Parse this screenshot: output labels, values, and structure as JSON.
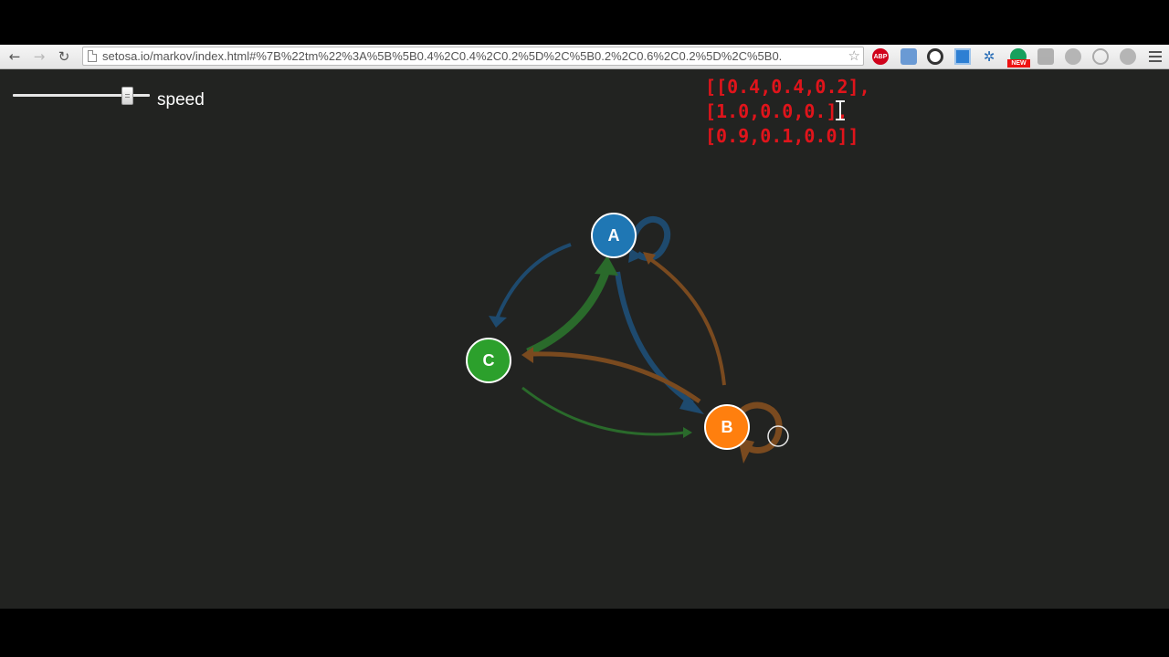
{
  "browser": {
    "url": "setosa.io/markov/index.html#%7B%22tm%22%3A%5B%5B0.4%2C0.4%2C0.2%5D%2C%5B0.2%2C0.6%2C0.2%5D%2C%5B0.",
    "nav": {
      "back_icon": "←",
      "forward_icon": "→",
      "reload_icon": "↻",
      "star_icon": "☆"
    },
    "extensions": {
      "abp_label": "ABP",
      "new_badge": "NEW"
    }
  },
  "controls": {
    "speed_label": "speed",
    "speed_slider_value": 0.87
  },
  "matrix": {
    "rows": [
      "[[0.4,0.4,0.2],",
      "[1.0,0.0,0.",
      "[0.9,0.1,0.0]]"
    ],
    "row_suffix_after_cursor": "],"
  },
  "graph": {
    "nodes": [
      {
        "id": "A",
        "label": "A",
        "color": "#1f77b4"
      },
      {
        "id": "B",
        "label": "B",
        "color": "#ff7f0e"
      },
      {
        "id": "C",
        "label": "C",
        "color": "#2ca02c"
      }
    ],
    "edge_colors": {
      "from_A": "#1e4a6e",
      "from_B": "#7a4a1f",
      "from_C": "#2a6a2b"
    }
  },
  "colors": {
    "background": "#222321",
    "matrix_text": "#e0141b",
    "node_border": "#ffffff"
  }
}
